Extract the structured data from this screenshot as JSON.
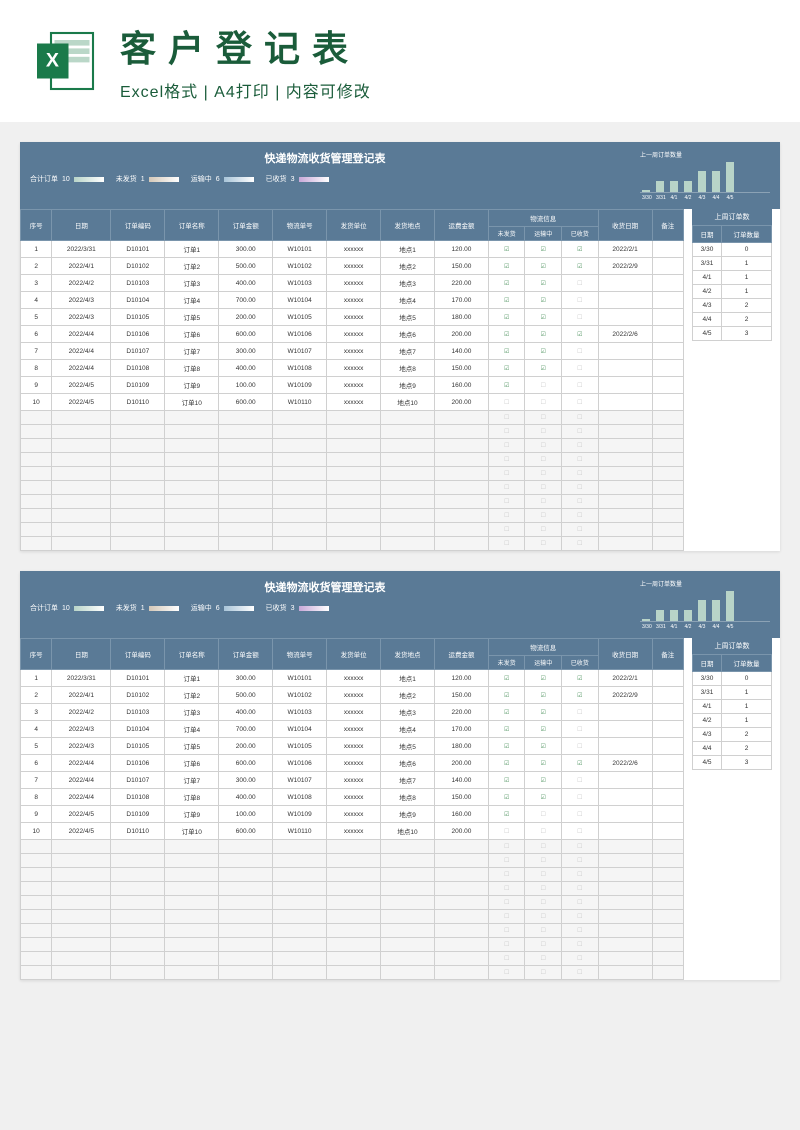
{
  "header": {
    "title": "客户登记表",
    "subtitle": "Excel格式 | A4打印 | 内容可修改"
  },
  "sheet": {
    "title": "快递物流收货管理登记表",
    "stats": {
      "total_label": "合计订单",
      "total_val": "10",
      "unship_label": "未发货",
      "unship_val": "1",
      "transit_label": "运输中",
      "transit_val": "6",
      "received_label": "已收货",
      "received_val": "3"
    },
    "chart": {
      "title": "上一周订单数量",
      "labels": [
        "3/30",
        "3/31",
        "4/1",
        "4/2",
        "4/3",
        "4/4",
        "4/5"
      ]
    },
    "cols": {
      "seq": "序号",
      "date": "日期",
      "ono": "订单编码",
      "oname": "订单名称",
      "amt": "订单金额",
      "lno": "物流单号",
      "sunit": "发货单位",
      "sloc": "发货地点",
      "famt": "运费金额",
      "linfo": "物流信息",
      "unship": "未发货",
      "transit": "运输中",
      "received": "已收货",
      "rdate": "收货日期",
      "note": "备注"
    },
    "rows": [
      {
        "seq": "1",
        "date": "2022/3/31",
        "ono": "D10101",
        "oname": "订单1",
        "amt": "300.00",
        "lno": "W10101",
        "sunit": "xxxxxx",
        "sloc": "地点1",
        "famt": "120.00",
        "u": "☑",
        "t": "☑",
        "r": "☑",
        "rdate": "2022/2/1"
      },
      {
        "seq": "2",
        "date": "2022/4/1",
        "ono": "D10102",
        "oname": "订单2",
        "amt": "500.00",
        "lno": "W10102",
        "sunit": "xxxxxx",
        "sloc": "地点2",
        "famt": "150.00",
        "u": "☑",
        "t": "☑",
        "r": "☑",
        "rdate": "2022/2/9"
      },
      {
        "seq": "3",
        "date": "2022/4/2",
        "ono": "D10103",
        "oname": "订单3",
        "amt": "400.00",
        "lno": "W10103",
        "sunit": "xxxxxx",
        "sloc": "地点3",
        "famt": "220.00",
        "u": "☑",
        "t": "☑",
        "r": "☐",
        "rdate": ""
      },
      {
        "seq": "4",
        "date": "2022/4/3",
        "ono": "D10104",
        "oname": "订单4",
        "amt": "700.00",
        "lno": "W10104",
        "sunit": "xxxxxx",
        "sloc": "地点4",
        "famt": "170.00",
        "u": "☑",
        "t": "☑",
        "r": "☐",
        "rdate": ""
      },
      {
        "seq": "5",
        "date": "2022/4/3",
        "ono": "D10105",
        "oname": "订单5",
        "amt": "200.00",
        "lno": "W10105",
        "sunit": "xxxxxx",
        "sloc": "地点5",
        "famt": "180.00",
        "u": "☑",
        "t": "☑",
        "r": "☐",
        "rdate": ""
      },
      {
        "seq": "6",
        "date": "2022/4/4",
        "ono": "D10106",
        "oname": "订单6",
        "amt": "600.00",
        "lno": "W10106",
        "sunit": "xxxxxx",
        "sloc": "地点6",
        "famt": "200.00",
        "u": "☑",
        "t": "☑",
        "r": "☑",
        "rdate": "2022/2/6"
      },
      {
        "seq": "7",
        "date": "2022/4/4",
        "ono": "D10107",
        "oname": "订单7",
        "amt": "300.00",
        "lno": "W10107",
        "sunit": "xxxxxx",
        "sloc": "地点7",
        "famt": "140.00",
        "u": "☑",
        "t": "☑",
        "r": "☐",
        "rdate": ""
      },
      {
        "seq": "8",
        "date": "2022/4/4",
        "ono": "D10108",
        "oname": "订单8",
        "amt": "400.00",
        "lno": "W10108",
        "sunit": "xxxxxx",
        "sloc": "地点8",
        "famt": "150.00",
        "u": "☑",
        "t": "☑",
        "r": "☐",
        "rdate": ""
      },
      {
        "seq": "9",
        "date": "2022/4/5",
        "ono": "D10109",
        "oname": "订单9",
        "amt": "100.00",
        "lno": "W10109",
        "sunit": "xxxxxx",
        "sloc": "地点9",
        "famt": "160.00",
        "u": "☑",
        "t": "☐",
        "r": "☐",
        "rdate": ""
      },
      {
        "seq": "10",
        "date": "2022/4/5",
        "ono": "D10110",
        "oname": "订单10",
        "amt": "600.00",
        "lno": "W10110",
        "sunit": "xxxxxx",
        "sloc": "地点10",
        "famt": "200.00",
        "u": "☐",
        "t": "☐",
        "r": "☐",
        "rdate": ""
      }
    ],
    "side": {
      "title": "上周订单数",
      "h1": "日期",
      "h2": "订单数量",
      "rows": [
        {
          "d": "3/30",
          "c": "0"
        },
        {
          "d": "3/31",
          "c": "1"
        },
        {
          "d": "4/1",
          "c": "1"
        },
        {
          "d": "4/2",
          "c": "1"
        },
        {
          "d": "4/3",
          "c": "2"
        },
        {
          "d": "4/4",
          "c": "2"
        },
        {
          "d": "4/5",
          "c": "3"
        }
      ]
    }
  },
  "chart_data": {
    "type": "bar",
    "title": "上一周订单数量",
    "categories": [
      "3/30",
      "3/31",
      "4/1",
      "4/2",
      "4/3",
      "4/4",
      "4/5"
    ],
    "values": [
      0,
      1,
      1,
      1,
      2,
      2,
      3
    ],
    "xlabel": "日期",
    "ylabel": "订单数量",
    "ylim": [
      0,
      3
    ]
  }
}
